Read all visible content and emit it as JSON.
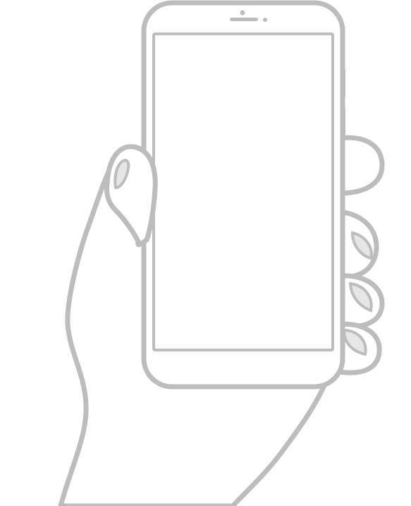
{
  "illustration": {
    "subject": "hand-holding-smartphone",
    "style": "line-art",
    "colors": {
      "outline": "#bdbdbd",
      "fill": "#ffffff",
      "nail": "#e6e6e6"
    },
    "phone": {
      "screen_content": "",
      "icons": [
        "speaker-icon",
        "front-camera-icon",
        "sensor-icon"
      ]
    }
  }
}
